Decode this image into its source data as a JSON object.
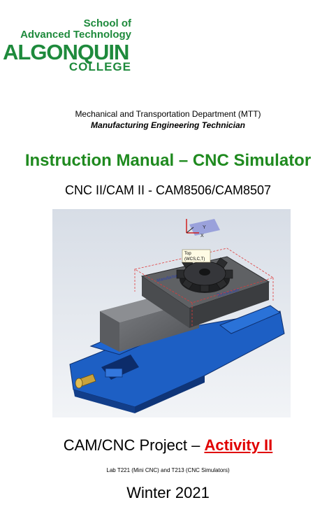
{
  "logo": {
    "school_line1": "School of",
    "school_line2": "Advanced Technology",
    "name": "ALGONQUIN",
    "college": "COLLEGE"
  },
  "header": {
    "department": "Mechanical and Transportation Department (MTT)",
    "program": "Manufacturing Engineering Technician"
  },
  "title": "Instruction Manual – CNC Simulator",
  "course": "CNC II/CAM II - CAM8506/CAM8507",
  "figure": {
    "label_top": "Top",
    "label_wcs": "(WCS,C,T)",
    "axis_x": "X",
    "axis_y": "Y",
    "engraving1": "Manufacturing",
    "engraving2": "Technician"
  },
  "project": {
    "prefix": "CAM/CNC Project – ",
    "activity": "Activity II"
  },
  "lab": "Lab T221 (Mini CNC) and T213 (CNC Simulators)",
  "term": "Winter 2021",
  "colors": {
    "brand_green": "#1e8a3c",
    "title_green": "#1f8a1f",
    "activity_red": "#e00000",
    "vise_blue": "#1d5fc4"
  }
}
